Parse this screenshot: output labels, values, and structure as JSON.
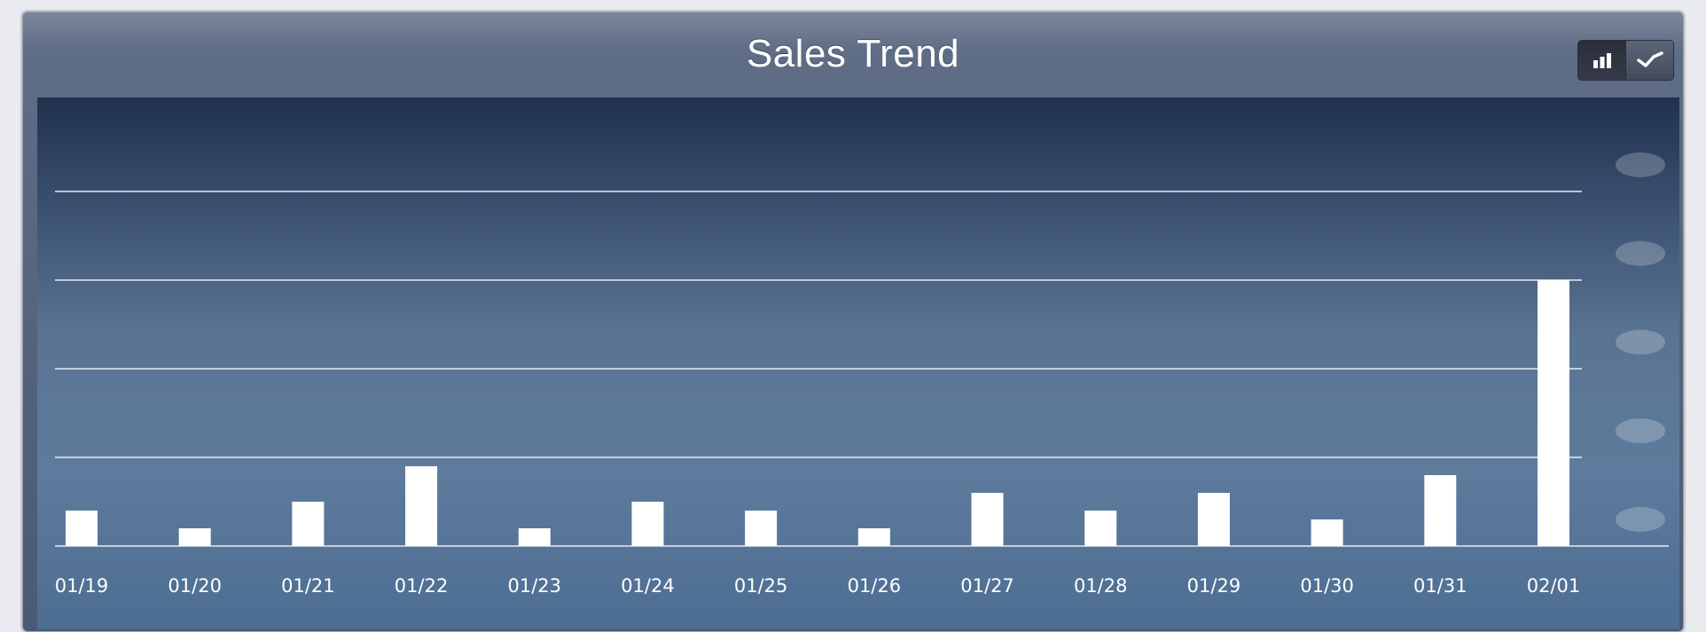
{
  "title": "Sales Trend",
  "toggle": {
    "buttons": [
      {
        "icon": "bar-chart-icon",
        "active": true
      },
      {
        "icon": "line-chart-icon",
        "active": false
      }
    ]
  },
  "chart_data": {
    "type": "bar",
    "title": "Sales Trend",
    "categories": [
      "01/19",
      "01/20",
      "01/21",
      "01/22",
      "01/23",
      "01/24",
      "01/25",
      "01/26",
      "01/27",
      "01/28",
      "01/29",
      "01/30",
      "01/31",
      "02/01"
    ],
    "values": [
      4,
      2,
      5,
      9,
      2,
      5,
      4,
      2,
      6,
      4,
      6,
      3,
      8,
      30
    ],
    "ylim": [
      0,
      40
    ],
    "grid": true,
    "y_gridlines": 4,
    "bar_color": "#ffffff"
  }
}
